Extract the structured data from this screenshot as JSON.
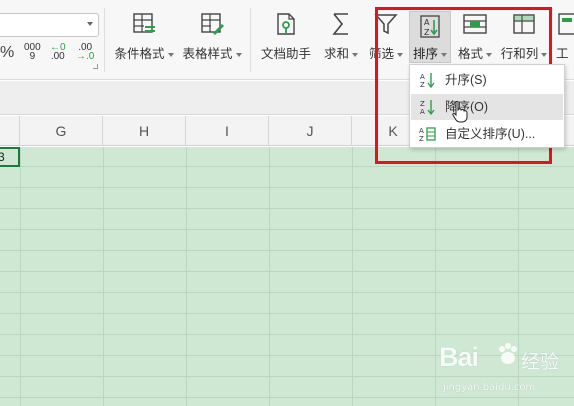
{
  "ribbon": {
    "number_format": {
      "percent": "%",
      "thousands": "000",
      "thousands_sub": "9",
      "inc_decimal": "←0",
      "inc_decimal_sub": ".00",
      "dec_decimal": ".00",
      "dec_decimal_sub": "→.0"
    },
    "tools": [
      {
        "id": "conditional-format",
        "label": "条件格式",
        "icon": "conditional-format-icon"
      },
      {
        "id": "table-style",
        "label": "表格样式",
        "icon": "table-style-icon"
      },
      {
        "id": "doc-assistant",
        "label": "文档助手",
        "icon": "doc-assistant-icon"
      },
      {
        "id": "sum",
        "label": "求和",
        "icon": "sigma-icon"
      },
      {
        "id": "filter",
        "label": "筛选",
        "icon": "funnel-icon"
      },
      {
        "id": "sort",
        "label": "排序",
        "icon": "sort-az-icon"
      },
      {
        "id": "format",
        "label": "格式",
        "icon": "format-icon"
      },
      {
        "id": "rows-cols",
        "label": "行和列",
        "icon": "rows-cols-icon"
      },
      {
        "id": "worksheet",
        "label": "工",
        "icon": "worksheet-icon"
      }
    ]
  },
  "columns": [
    "G",
    "H",
    "I",
    "J",
    "K"
  ],
  "active_cell_text": "3",
  "sort_menu": {
    "items": [
      {
        "label": "升序(S)",
        "icon": "sort-ascending-icon"
      },
      {
        "label": "降序(O)",
        "icon": "sort-descending-icon"
      },
      {
        "label": "自定义排序(U)...",
        "icon": "custom-sort-icon"
      }
    ]
  },
  "watermark": {
    "brand": "Bai",
    "brand2": "经验",
    "url": "jingyan.baidu.com"
  },
  "colors": {
    "highlight_box": "#e8101a",
    "grid_bg": "#cfe8d3",
    "icon_green": "#2e9e4a",
    "active_cell_border": "#1f7a3a"
  }
}
